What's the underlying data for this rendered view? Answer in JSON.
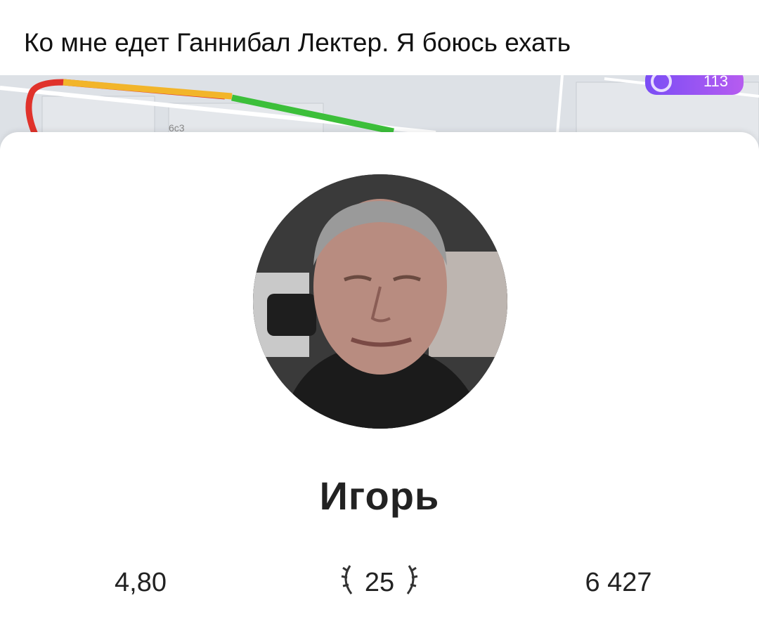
{
  "caption": "Ко мне едет Ганнибал Лектер. Я боюсь ехать",
  "map": {
    "route_badge_label": "113",
    "route_colors": [
      "#e0322b",
      "#f2b52a",
      "#3cbf3a"
    ]
  },
  "driver": {
    "name": "Игорь",
    "photo_icon": "driver-photo"
  },
  "stats": {
    "rating": "4,80",
    "years": "25",
    "trips": "6 427"
  }
}
